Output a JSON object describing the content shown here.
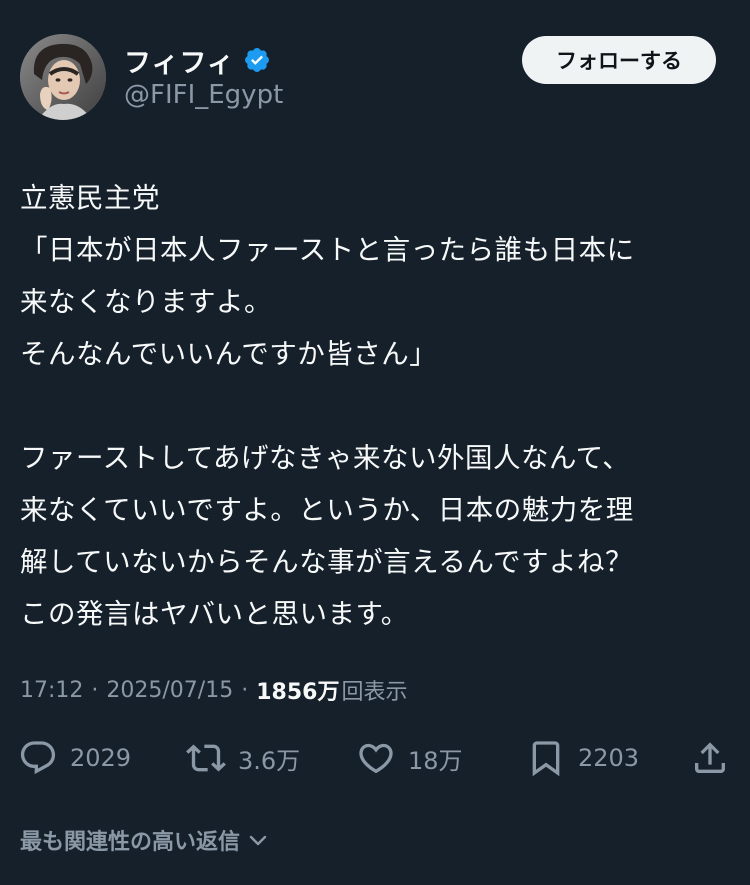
{
  "author": {
    "display_name": "フィフィ",
    "handle": "@FIFI_Egypt",
    "verified_icon": "verified-badge-icon",
    "avatar_icon": "profile-photo"
  },
  "follow_button": {
    "label": "フォローする"
  },
  "tweet": {
    "lines": [
      "立憲民主党",
      "「日本が日本人ファーストと言ったら誰も日本に",
      "来なくなりますよ。",
      "そんなんでいいんですか皆さん」",
      "",
      "ファーストしてあげなきゃ来ない外国人なんて、",
      "来なくていいですよ。というか、日本の魅力を理",
      "解していないからそんな事が言えるんですよね？",
      "この発言はヤバいと思います。"
    ]
  },
  "meta": {
    "time": "17:12",
    "separator": "·",
    "date": "2025/07/15",
    "views_count": "1856万",
    "views_label": "回表示"
  },
  "actions": {
    "reply_count": "2029",
    "retweet_count": "3.6万",
    "like_count": "18万",
    "bookmark_count": "2203"
  },
  "replies_filter": {
    "label": "最も関連性の高い返信"
  },
  "colors": {
    "background": "#15202b",
    "text_primary": "#f7f9f9",
    "text_secondary": "#8b98a5",
    "verified_blue": "#1d9bf0",
    "follow_bg": "#eff3f4"
  }
}
